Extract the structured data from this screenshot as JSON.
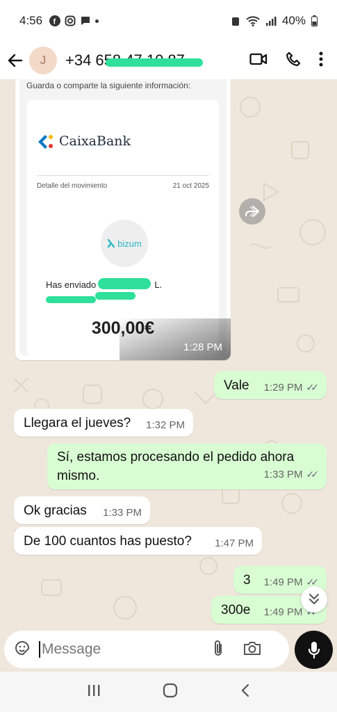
{
  "status_bar": {
    "time": "4:56",
    "battery": "40%"
  },
  "contact": {
    "initial": "J",
    "name": "+34 658 47 10 87"
  },
  "receipt": {
    "header": "Guarda o comparte la siguiente información:",
    "bank": "CaixaBank",
    "detail_label": "Detalle del movimiento",
    "date": "21 oct 2025",
    "service": "bizum",
    "sent_text": "Has enviado a",
    "recipient_fragment": "L.",
    "amount": "300,00€",
    "time": "1:28 PM"
  },
  "messages": [
    {
      "side": "out",
      "text": "Vale",
      "time": "1:29 PM",
      "read": true
    },
    {
      "side": "in",
      "text": "Llegara el jueves?",
      "time": "1:32 PM"
    },
    {
      "side": "out",
      "text": "Sí, estamos procesando el pedido ahora mismo.",
      "time": "1:33 PM",
      "read": true
    },
    {
      "side": "in",
      "text": "Ok gracias",
      "time": "1:33 PM"
    },
    {
      "side": "in",
      "text": "De 100 cuantos has puesto?",
      "time": "1:47 PM"
    },
    {
      "side": "out",
      "text": "3",
      "time": "1:49 PM",
      "read": true
    },
    {
      "side": "out",
      "text": "300e",
      "time": "1:49 PM",
      "read": true
    }
  ],
  "composer": {
    "placeholder": "Message"
  },
  "colors": {
    "outgoing": "#d9fdd3",
    "incoming": "#ffffff",
    "background": "#efe7dc",
    "accent": "#2fe09a"
  },
  "icons": [
    "back-arrow-icon",
    "video-call-icon",
    "phone-icon",
    "more-vert-icon",
    "sticker-icon",
    "attach-icon",
    "camera-icon",
    "mic-icon",
    "forward-icon",
    "scroll-down-icon"
  ]
}
